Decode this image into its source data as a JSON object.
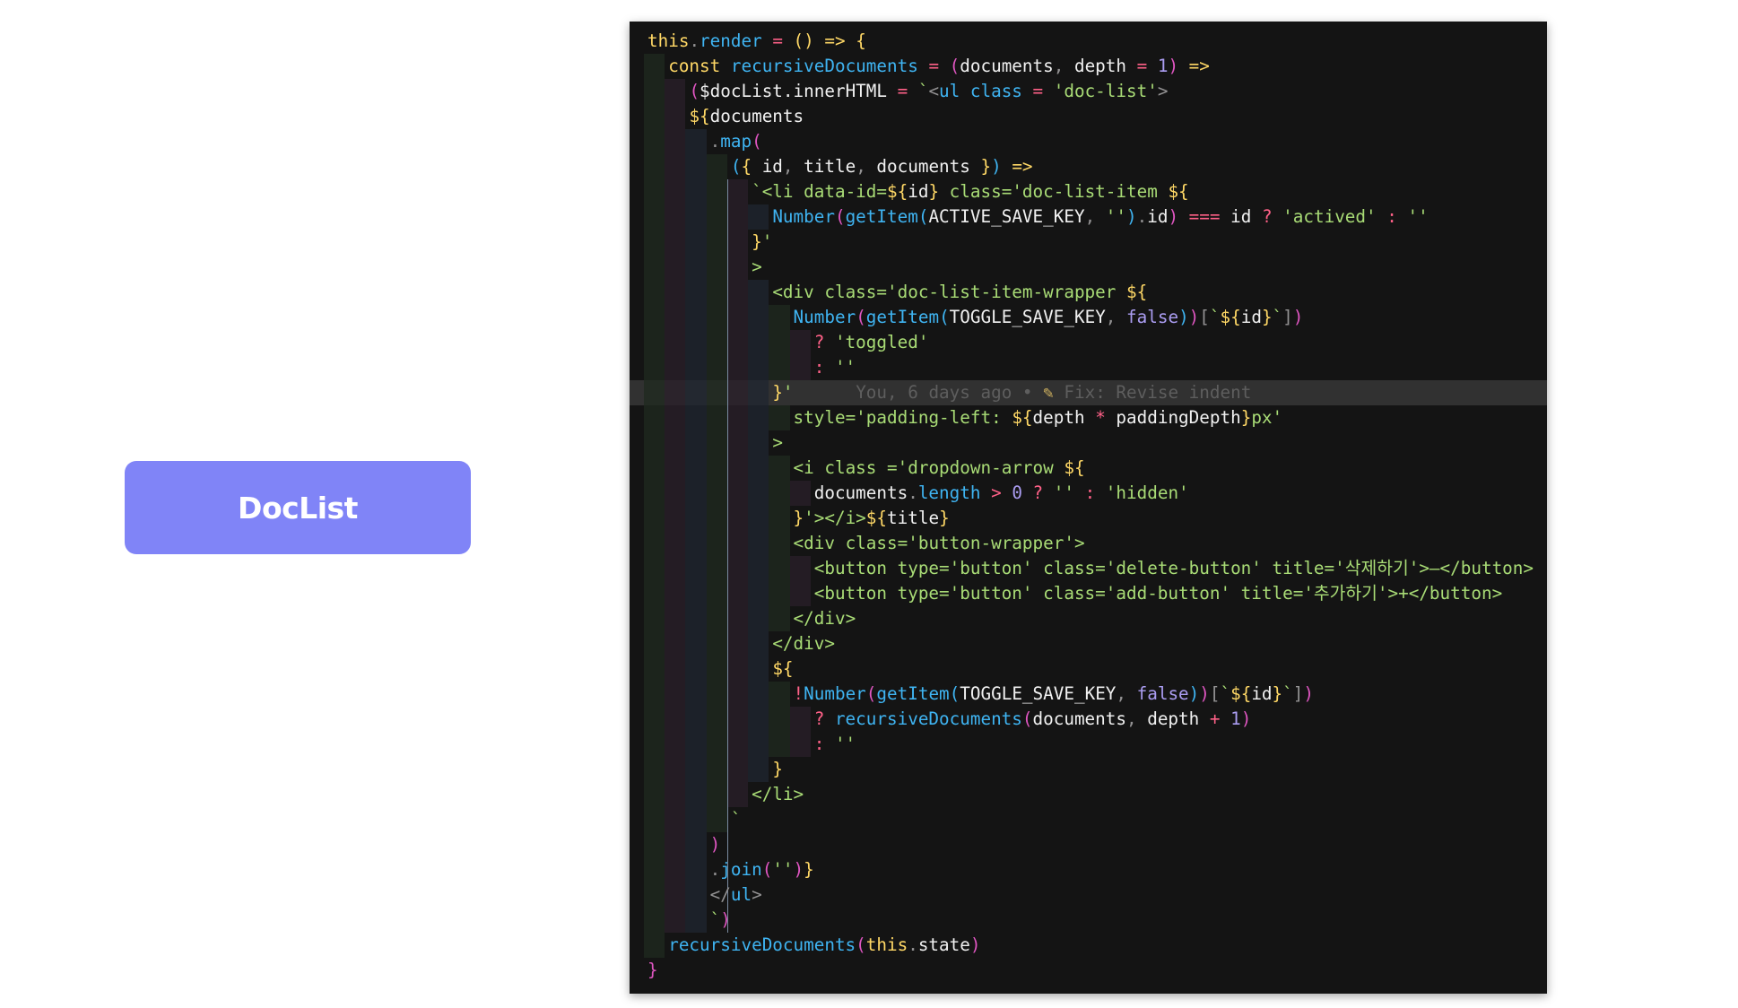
{
  "button": {
    "label": "DocList"
  },
  "editor": {
    "colors": {
      "background": "#141414",
      "blame_band": "#313131",
      "keyword": "#ffd866",
      "function": "#3fb4f2",
      "string": "#a9dc76",
      "number": "#ab9df2",
      "operator": "#ff6188",
      "bracket_pink": "#e056c2"
    },
    "blame": {
      "author": "You",
      "when": "6 days ago",
      "separator": "•",
      "icon": "git-commit-icon",
      "message": "Fix: Revise indent"
    },
    "lines": [
      [
        [
          "kw",
          "this"
        ],
        [
          "punc",
          "."
        ],
        [
          "fn",
          "render"
        ],
        [
          "var",
          " "
        ],
        [
          "op",
          "="
        ],
        [
          "var",
          " "
        ],
        [
          "br1",
          "("
        ],
        [
          "br1",
          ")"
        ],
        [
          "var",
          " "
        ],
        [
          "kw",
          "=>"
        ],
        [
          "var",
          " "
        ],
        [
          "br1",
          "{"
        ]
      ],
      [
        [
          "var",
          "  "
        ],
        [
          "kw",
          "const"
        ],
        [
          "var",
          " "
        ],
        [
          "fn",
          "recursiveDocuments"
        ],
        [
          "var",
          " "
        ],
        [
          "op",
          "="
        ],
        [
          "var",
          " "
        ],
        [
          "br2",
          "("
        ],
        [
          "var",
          "documents"
        ],
        [
          "punc",
          ","
        ],
        [
          "var",
          " depth "
        ],
        [
          "op",
          "="
        ],
        [
          "var",
          " "
        ],
        [
          "num",
          "1"
        ],
        [
          "br2",
          ")"
        ],
        [
          "var",
          " "
        ],
        [
          "kw",
          "=>"
        ]
      ],
      [
        [
          "var",
          "    "
        ],
        [
          "br2",
          "("
        ],
        [
          "var",
          "$docList.innerHTML "
        ],
        [
          "op",
          "="
        ],
        [
          "var",
          " "
        ],
        [
          "str",
          "`"
        ],
        [
          "punc",
          "<"
        ],
        [
          "fn",
          "ul"
        ],
        [
          "var",
          " "
        ],
        [
          "fn",
          "class"
        ],
        [
          "var",
          " "
        ],
        [
          "op",
          "="
        ],
        [
          "var",
          " "
        ],
        [
          "str",
          "'doc-list'"
        ],
        [
          "punc",
          ">"
        ]
      ],
      [
        [
          "var",
          "    "
        ],
        [
          "kw",
          "${"
        ],
        [
          "var",
          "documents"
        ]
      ],
      [
        [
          "var",
          "      "
        ],
        [
          "punc",
          "."
        ],
        [
          "fn",
          "map"
        ],
        [
          "br2",
          "("
        ]
      ],
      [
        [
          "var",
          "        "
        ],
        [
          "br3",
          "("
        ],
        [
          "br1",
          "{"
        ],
        [
          "var",
          " id"
        ],
        [
          "punc",
          ","
        ],
        [
          "var",
          " title"
        ],
        [
          "punc",
          ","
        ],
        [
          "var",
          " documents "
        ],
        [
          "br1",
          "}"
        ],
        [
          "br3",
          ")"
        ],
        [
          "var",
          " "
        ],
        [
          "kw",
          "=>"
        ]
      ],
      [
        [
          "var",
          "          "
        ],
        [
          "str",
          "`<li data-id="
        ],
        [
          "kw",
          "${"
        ],
        [
          "var",
          "id"
        ],
        [
          "kw",
          "}"
        ],
        [
          "str",
          " class='doc-list-item "
        ],
        [
          "kw",
          "${"
        ]
      ],
      [
        [
          "var",
          "            "
        ],
        [
          "fn",
          "Number"
        ],
        [
          "br2",
          "("
        ],
        [
          "fn",
          "getItem"
        ],
        [
          "br3",
          "("
        ],
        [
          "var",
          "ACTIVE_SAVE_KEY"
        ],
        [
          "punc",
          ","
        ],
        [
          "var",
          " "
        ],
        [
          "str",
          "''"
        ],
        [
          "br3",
          ")"
        ],
        [
          "punc",
          "."
        ],
        [
          "var",
          "id"
        ],
        [
          "br2",
          ")"
        ],
        [
          "var",
          " "
        ],
        [
          "op",
          "==="
        ],
        [
          "var",
          " id "
        ],
        [
          "op",
          "?"
        ],
        [
          "var",
          " "
        ],
        [
          "str",
          "'actived'"
        ],
        [
          "var",
          " "
        ],
        [
          "op",
          ":"
        ],
        [
          "var",
          " "
        ],
        [
          "str",
          "''"
        ]
      ],
      [
        [
          "var",
          "          "
        ],
        [
          "kw",
          "}"
        ],
        [
          "str",
          "'"
        ]
      ],
      [
        [
          "var",
          "          "
        ],
        [
          "str",
          ">"
        ]
      ],
      [
        [
          "var",
          "            "
        ],
        [
          "str",
          "<div class='doc-list-item-wrapper "
        ],
        [
          "kw",
          "${"
        ]
      ],
      [
        [
          "var",
          "              "
        ],
        [
          "fn",
          "Number"
        ],
        [
          "br2",
          "("
        ],
        [
          "fn",
          "getItem"
        ],
        [
          "br3",
          "("
        ],
        [
          "var",
          "TOGGLE_SAVE_KEY"
        ],
        [
          "punc",
          ","
        ],
        [
          "var",
          " "
        ],
        [
          "num",
          "false"
        ],
        [
          "br3",
          ")"
        ],
        [
          "br2",
          ")"
        ],
        [
          "punc",
          "["
        ],
        [
          "str",
          "`"
        ],
        [
          "kw",
          "${"
        ],
        [
          "var",
          "id"
        ],
        [
          "kw",
          "}"
        ],
        [
          "str",
          "`"
        ],
        [
          "punc",
          "]"
        ],
        [
          "br2",
          ")"
        ]
      ],
      [
        [
          "var",
          "                "
        ],
        [
          "op",
          "?"
        ],
        [
          "var",
          " "
        ],
        [
          "str",
          "'toggled'"
        ]
      ],
      [
        [
          "var",
          "                "
        ],
        [
          "op",
          ":"
        ],
        [
          "var",
          " "
        ],
        [
          "str",
          "''"
        ]
      ],
      [
        [
          "var",
          "            "
        ],
        [
          "kw",
          "}"
        ],
        [
          "str",
          "'"
        ]
      ],
      [
        [
          "var",
          "              "
        ],
        [
          "str",
          "style='padding-left: "
        ],
        [
          "kw",
          "${"
        ],
        [
          "var",
          "depth "
        ],
        [
          "op",
          "*"
        ],
        [
          "var",
          " paddingDepth"
        ],
        [
          "kw",
          "}"
        ],
        [
          "str",
          "px'"
        ]
      ],
      [
        [
          "var",
          "            "
        ],
        [
          "str",
          ">"
        ]
      ],
      [
        [
          "var",
          "              "
        ],
        [
          "str",
          "<i class ='dropdown-arrow "
        ],
        [
          "kw",
          "${"
        ]
      ],
      [
        [
          "var",
          "                "
        ],
        [
          "var",
          "documents"
        ],
        [
          "punc",
          "."
        ],
        [
          "fn",
          "length"
        ],
        [
          "var",
          " "
        ],
        [
          "op",
          ">"
        ],
        [
          "var",
          " "
        ],
        [
          "num",
          "0"
        ],
        [
          "var",
          " "
        ],
        [
          "op",
          "?"
        ],
        [
          "var",
          " "
        ],
        [
          "str",
          "''"
        ],
        [
          "var",
          " "
        ],
        [
          "op",
          ":"
        ],
        [
          "var",
          " "
        ],
        [
          "str",
          "'hidden'"
        ]
      ],
      [
        [
          "var",
          "              "
        ],
        [
          "kw",
          "}"
        ],
        [
          "str",
          "'></i>"
        ],
        [
          "kw",
          "${"
        ],
        [
          "var",
          "title"
        ],
        [
          "kw",
          "}"
        ]
      ],
      [
        [
          "var",
          "              "
        ],
        [
          "str",
          "<div class='button-wrapper'>"
        ]
      ],
      [
        [
          "var",
          "                "
        ],
        [
          "str",
          "<button type='button' class='delete-button' title='삭제하기'>–</button>"
        ]
      ],
      [
        [
          "var",
          "                "
        ],
        [
          "str",
          "<button type='button' class='add-button' title='추가하기'>+</button>"
        ]
      ],
      [
        [
          "var",
          "              "
        ],
        [
          "str",
          "</div>"
        ]
      ],
      [
        [
          "var",
          "            "
        ],
        [
          "str",
          "</div>"
        ]
      ],
      [
        [
          "var",
          "            "
        ],
        [
          "kw",
          "${"
        ]
      ],
      [
        [
          "var",
          "              "
        ],
        [
          "op",
          "!"
        ],
        [
          "fn",
          "Number"
        ],
        [
          "br2",
          "("
        ],
        [
          "fn",
          "getItem"
        ],
        [
          "br3",
          "("
        ],
        [
          "var",
          "TOGGLE_SAVE_KEY"
        ],
        [
          "punc",
          ","
        ],
        [
          "var",
          " "
        ],
        [
          "num",
          "false"
        ],
        [
          "br3",
          ")"
        ],
        [
          "br2",
          ")"
        ],
        [
          "punc",
          "["
        ],
        [
          "str",
          "`"
        ],
        [
          "kw",
          "${"
        ],
        [
          "var",
          "id"
        ],
        [
          "kw",
          "}"
        ],
        [
          "str",
          "`"
        ],
        [
          "punc",
          "]"
        ],
        [
          "br2",
          ")"
        ]
      ],
      [
        [
          "var",
          "                "
        ],
        [
          "op",
          "?"
        ],
        [
          "var",
          " "
        ],
        [
          "fn",
          "recursiveDocuments"
        ],
        [
          "br2",
          "("
        ],
        [
          "var",
          "documents"
        ],
        [
          "punc",
          ","
        ],
        [
          "var",
          " depth "
        ],
        [
          "op",
          "+"
        ],
        [
          "var",
          " "
        ],
        [
          "num",
          "1"
        ],
        [
          "br2",
          ")"
        ]
      ],
      [
        [
          "var",
          "                "
        ],
        [
          "op",
          ":"
        ],
        [
          "var",
          " "
        ],
        [
          "str",
          "''"
        ]
      ],
      [
        [
          "var",
          "            "
        ],
        [
          "kw",
          "}"
        ]
      ],
      [
        [
          "var",
          "          "
        ],
        [
          "str",
          "</li>"
        ]
      ],
      [
        [
          "var",
          "        "
        ],
        [
          "str",
          "`"
        ]
      ],
      [
        [
          "var",
          "      "
        ],
        [
          "br2",
          ")"
        ]
      ],
      [
        [
          "var",
          "      "
        ],
        [
          "punc",
          "."
        ],
        [
          "fn",
          "join"
        ],
        [
          "br2",
          "("
        ],
        [
          "str",
          "''"
        ],
        [
          "br2",
          ")"
        ],
        [
          "kw",
          "}"
        ]
      ],
      [
        [
          "var",
          "      "
        ],
        [
          "punc",
          "</"
        ],
        [
          "fn",
          "ul"
        ],
        [
          "punc",
          ">"
        ]
      ],
      [
        [
          "var",
          "      "
        ],
        [
          "str",
          "`"
        ],
        [
          "br2",
          ")"
        ]
      ],
      [
        [
          "var",
          "  "
        ],
        [
          "fn",
          "recursiveDocuments"
        ],
        [
          "br2",
          "("
        ],
        [
          "kw",
          "this"
        ],
        [
          "punc",
          "."
        ],
        [
          "var",
          "state"
        ],
        [
          "br2",
          ")"
        ]
      ],
      [
        [
          "br2",
          "}"
        ]
      ]
    ]
  }
}
